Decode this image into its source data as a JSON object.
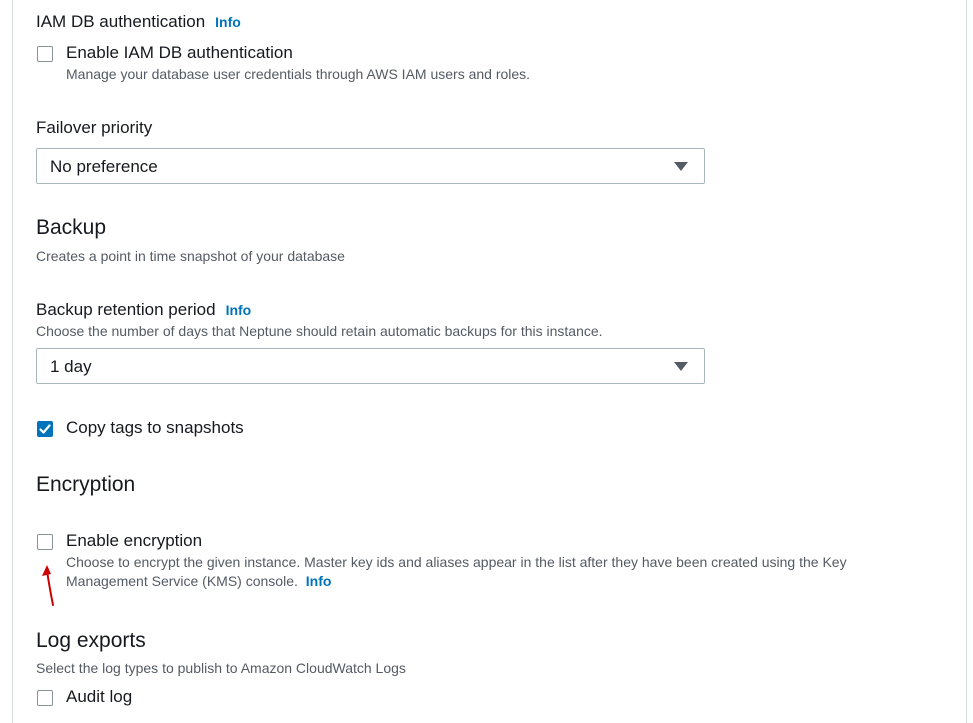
{
  "iam": {
    "heading": "IAM DB authentication",
    "info": "Info",
    "checkbox_label": "Enable IAM DB authentication",
    "checkbox_checked": false,
    "description": "Manage your database user credentials through AWS IAM users and roles."
  },
  "failover": {
    "label": "Failover priority",
    "selected": "No preference"
  },
  "backup": {
    "heading": "Backup",
    "description": "Creates a point in time snapshot of your database",
    "retention_label": "Backup retention period",
    "retention_info": "Info",
    "retention_description": "Choose the number of days that Neptune should retain automatic backups for this instance.",
    "retention_selected": "1 day",
    "copy_tags_label": "Copy tags to snapshots",
    "copy_tags_checked": true
  },
  "encryption": {
    "heading": "Encryption",
    "checkbox_label": "Enable encryption",
    "checkbox_checked": false,
    "description_line1": "Choose to encrypt the given instance. Master key ids and aliases appear in the list after they have been created using the Key",
    "description_line2": "Management Service (KMS) console.",
    "info": "Info",
    "annotation_arrow_color": "#cc0000"
  },
  "log_exports": {
    "heading": "Log exports",
    "description": "Select the log types to publish to Amazon CloudWatch Logs",
    "audit_log_label": "Audit log",
    "audit_log_checked": false
  },
  "colors": {
    "link": "#0073bb",
    "checkbox_checked": "#0073bb",
    "text": "#16191f",
    "muted": "#545b64"
  }
}
